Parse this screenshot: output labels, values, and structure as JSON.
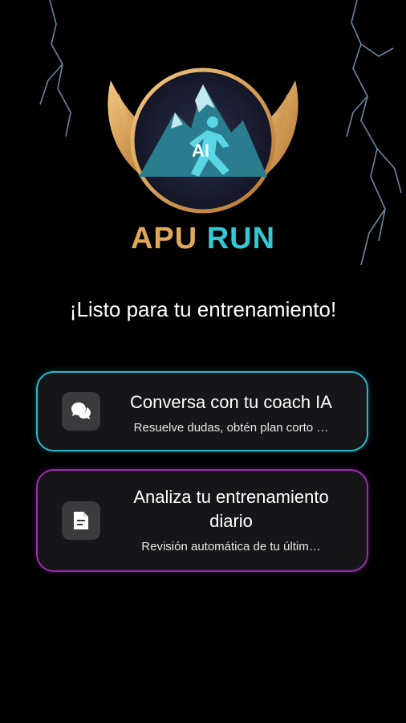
{
  "brand": {
    "left": "APU",
    "right": "RUN",
    "badge": "AI"
  },
  "heading": "¡Listo para tu entrenamiento!",
  "cards": [
    {
      "title": "Conversa con tu coach IA",
      "subtitle": "Resuelve dudas, obtén plan corto …",
      "icon": "chat-bubbles-icon",
      "accent": "#27b9cc"
    },
    {
      "title": "Analiza tu entrenamiento diario",
      "subtitle": "Revisión automática de tu últim…",
      "icon": "document-icon",
      "accent": "#9c2bb0"
    }
  ],
  "colors": {
    "background": "#000000",
    "brand_gold": "#e0a85a",
    "brand_cyan": "#34c8d6",
    "card_bg": "#161618"
  }
}
